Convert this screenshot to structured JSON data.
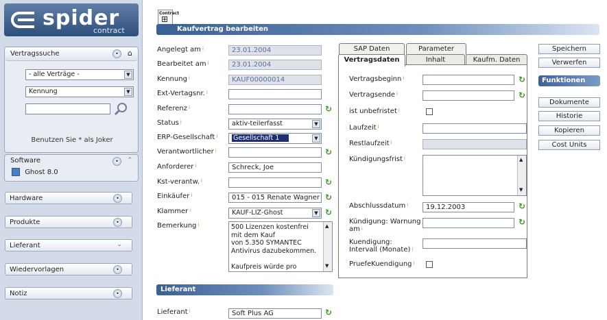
{
  "logo": {
    "text": "spider",
    "sub": "contract"
  },
  "sidebar": {
    "search_title": "Vertragssuche",
    "filter_select": "- alle Verträge -",
    "field_select": "Kennung",
    "search_value": "",
    "joker_hint": "Benutzen Sie * als Joker",
    "software_title": "Software",
    "software_item": "Ghost 8.0",
    "bars": [
      "Hardware",
      "Produkte",
      "Lieferant",
      "Wiedervorlagen",
      "Notiz"
    ]
  },
  "header": {
    "icon_label": "Contract",
    "title": "Kaufvertrag bearbeiten"
  },
  "form": {
    "angelegt_label": "Angelegt am",
    "angelegt": "23.01.2004",
    "bearbeitet_label": "Bearbeitet am",
    "bearbeitet": "23.01.2004",
    "kennung_label": "Kennung",
    "kennung": "KAUF00000014",
    "extnr_label": "Ext-Vertagsnr.",
    "extnr": "",
    "referenz_label": "Referenz",
    "referenz": "",
    "status_label": "Status",
    "status": "aktiv-teilerfasst",
    "erp_label": "ERP-Gesellschaft",
    "erp": "Gesellschaft 1",
    "verant_label": "Verantwortlicher",
    "verant": "",
    "anford_label": "Anforderer",
    "anford": "Schreck, Joe",
    "kst_label": "Kst-verantw.",
    "kst": "",
    "einkaeufer_label": "Einkäufer",
    "einkaeufer": "015 - 015  Renate Wagner",
    "klammer_label": "Klammer",
    "klammer": "KAUF-LIZ-Ghost",
    "bemerkung_label": "Bemerkung",
    "bemerkung": "500 Lizenzen kostenfrei\nmit dem Kauf\nvon 5.350 SYMANTEC\nAntivirus dazubekommen.\n\nKaufpreis würde pro"
  },
  "lieferant": {
    "title": "Lieferant",
    "label": "Lieferant",
    "value": "Soft Plus AG"
  },
  "tabs": {
    "sap": "SAP Daten",
    "parameter": "Parameter",
    "vertragsdaten": "Vertragsdaten",
    "inhalt": "Inhalt",
    "kaufm": "Kaufm. Daten"
  },
  "vertrag": {
    "beginn_label": "Vertragsbeginn",
    "beginn": "",
    "ende_label": "Vertragsende",
    "ende": "",
    "unbefristet_label": "ist unbefristet",
    "laufzeit_label": "Laufzeit",
    "laufzeit": "",
    "restlaufzeit_label": "Restlaufzeit",
    "restlaufzeit": "",
    "frist_label": "Kündigungsfrist",
    "frist": "",
    "abschluss_label": "Abschlussdatum",
    "abschluss": "19.12.2003",
    "warnung_label_1": "Kündigung: Warnung",
    "warnung_label_2": "am",
    "warnung": "",
    "intervall_label_1": "Kuendigung:",
    "intervall_label_2": "Intervall (Monate)",
    "intervall": "",
    "pruefe_label": "PruefeKuendigung"
  },
  "actions": {
    "save": "Speichern",
    "discard": "Verwerfen",
    "functions_title": "Funktionen",
    "items": [
      "Dokumente",
      "Historie",
      "Kopieren",
      "Cost Units"
    ]
  },
  "colors": {
    "accent": "#3a5f94",
    "refresh": "#3b9a24",
    "sidebar": "#d3dbe8"
  }
}
